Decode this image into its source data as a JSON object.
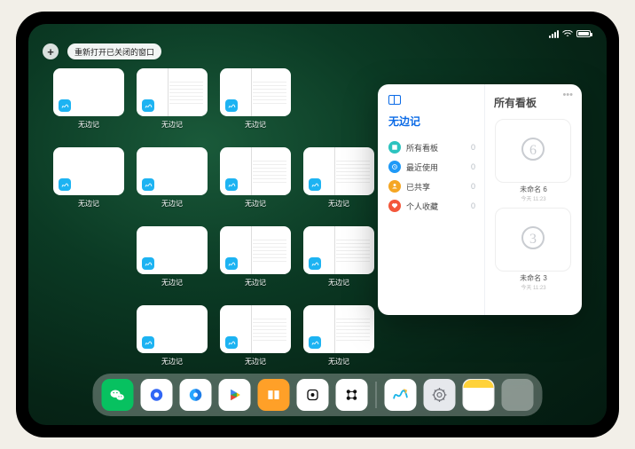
{
  "status": {
    "time": "",
    "wifi": "wifi",
    "battery": "100%"
  },
  "toolbar": {
    "plus": "+",
    "restore_label": "重新打开已关闭的窗口"
  },
  "thumb_label": "无边记",
  "thumbnails": [
    {
      "style": "plain"
    },
    {
      "style": "split"
    },
    {
      "style": "split"
    },
    {
      "style": "plain"
    },
    {
      "style": "plain"
    },
    {
      "style": "split"
    },
    {
      "style": "split"
    },
    {
      "style": "plain"
    },
    {
      "style": "split"
    },
    {
      "style": "split"
    },
    {
      "style": "plain"
    },
    {
      "style": "split"
    },
    {
      "style": "split"
    }
  ],
  "popover": {
    "left_title": "无边记",
    "rows": [
      {
        "icon": "teal",
        "name": "所有看板",
        "count": 0
      },
      {
        "icon": "blue",
        "name": "最近使用",
        "count": 0
      },
      {
        "icon": "amber",
        "name": "已共享",
        "count": 0
      },
      {
        "icon": "red",
        "name": "个人收藏",
        "count": 0
      }
    ],
    "right_title": "所有看板",
    "boards": [
      {
        "glyph": "6",
        "name": "未命名 6",
        "time": "今天 11:23"
      },
      {
        "glyph": "3",
        "name": "未命名 3",
        "time": "今天 11:23"
      }
    ]
  },
  "dock": {
    "apps": [
      {
        "id": "wechat",
        "cls": "wechat"
      },
      {
        "id": "browser1",
        "cls": "white"
      },
      {
        "id": "browser2",
        "cls": "white"
      },
      {
        "id": "play",
        "cls": "gplay"
      },
      {
        "id": "books",
        "cls": "books"
      },
      {
        "id": "roll",
        "cls": "white"
      },
      {
        "id": "dots",
        "cls": "white"
      }
    ],
    "apps2": [
      {
        "id": "freeform",
        "cls": "white"
      },
      {
        "id": "settings",
        "cls": "settings"
      },
      {
        "id": "notes",
        "cls": "notes"
      },
      {
        "id": "folder",
        "cls": "folder"
      }
    ]
  }
}
